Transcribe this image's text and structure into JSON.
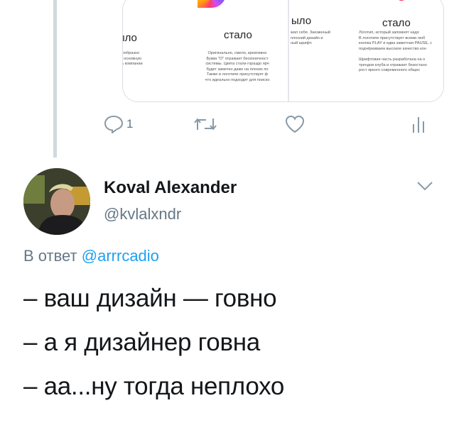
{
  "media": {
    "left_panel": {
      "title_before": "Было",
      "title_after": "стало",
      "text_before": "кучно, однообразно\n· отражает основную\nятельность компании",
      "text_after": "Оригинально, смело, креативно\nБуква \"О\" отражает бесконечност\nсистемы. Цвета стали гораздо ярч\nбудет заметен даже на плохих по\nТакже в логотипе присутствует ф\nчто идеально подходит для поиско"
    },
    "right_panel": {
      "title_before": "ыло",
      "title_after": "стало",
      "text_before": "жил себя. Заезженый\nплоский дизайн и\nный шрифт.",
      "text_after": "Логотип, который запомнят надо\nВ логотипе присутствует всеми люб\nкнопка PLAY и едва заметная PAUSE, с\nподчёркиваем высокое качество кон\n\nШрифтовая часть разработана на о\nтрендов клуба и отражает безостано\nрост яркого современного общес"
    }
  },
  "actions": {
    "reply_count": "1",
    "reply_icon": "reply-icon",
    "retweet_icon": "retweet-icon",
    "like_icon": "heart-icon",
    "analytics_icon": "analytics-icon"
  },
  "author": {
    "name": "Koval Alexander",
    "handle": "@kvlalxndr"
  },
  "reply": {
    "prefix": "В ответ",
    "mention": "@arrrcadio"
  },
  "tweet": {
    "lines": [
      "– ваш дизайн — говно",
      "– а я дизайнер говна",
      "– аа...ну тогда неплохо"
    ]
  },
  "colors": {
    "accent": "#1da1f2",
    "muted": "#657786",
    "icon": "#8899a6"
  }
}
